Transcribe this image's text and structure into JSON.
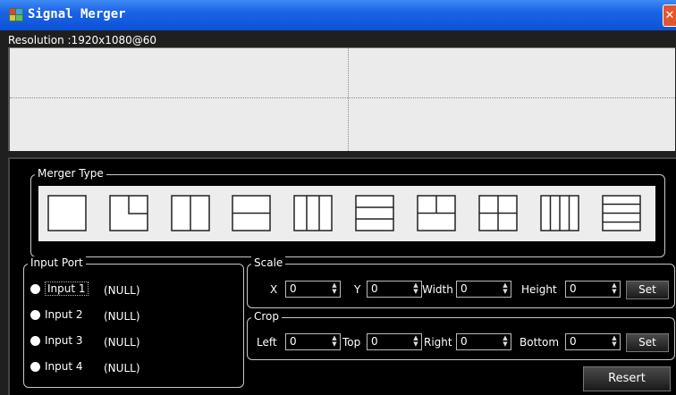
{
  "window": {
    "title": "Signal Merger",
    "close_glyph": "✕",
    "resolution": "Resolution :1920x1080@60"
  },
  "merger_type": {
    "label": "Merger Type",
    "options": [
      "full",
      "pip",
      "split-2-vertical",
      "split-2-horizontal",
      "split-3-vertical",
      "split-3-horizontal",
      "quad-top-split",
      "quad",
      "split-4-vertical",
      "split-4-horizontal"
    ]
  },
  "input_port": {
    "label": "Input Port",
    "inputs": [
      {
        "label": "Input 1",
        "value": "(NULL)"
      },
      {
        "label": "Input 2",
        "value": "(NULL)"
      },
      {
        "label": "Input 3",
        "value": "(NULL)"
      },
      {
        "label": "Input 4",
        "value": "(NULL)"
      }
    ]
  },
  "scale": {
    "label": "Scale",
    "x_label": "X",
    "x": "0",
    "y_label": "Y",
    "y": "0",
    "width_label": "Width",
    "width": "0",
    "height_label": "Height",
    "height": "0",
    "set_label": "Set"
  },
  "crop": {
    "label": "Crop",
    "left_label": "Left",
    "left": "0",
    "top_label": "Top",
    "top": "0",
    "right_label": "Right",
    "right": "0",
    "bottom_label": "Bottom",
    "bottom": "0",
    "set_label": "Set"
  },
  "resert_label": "Resert"
}
